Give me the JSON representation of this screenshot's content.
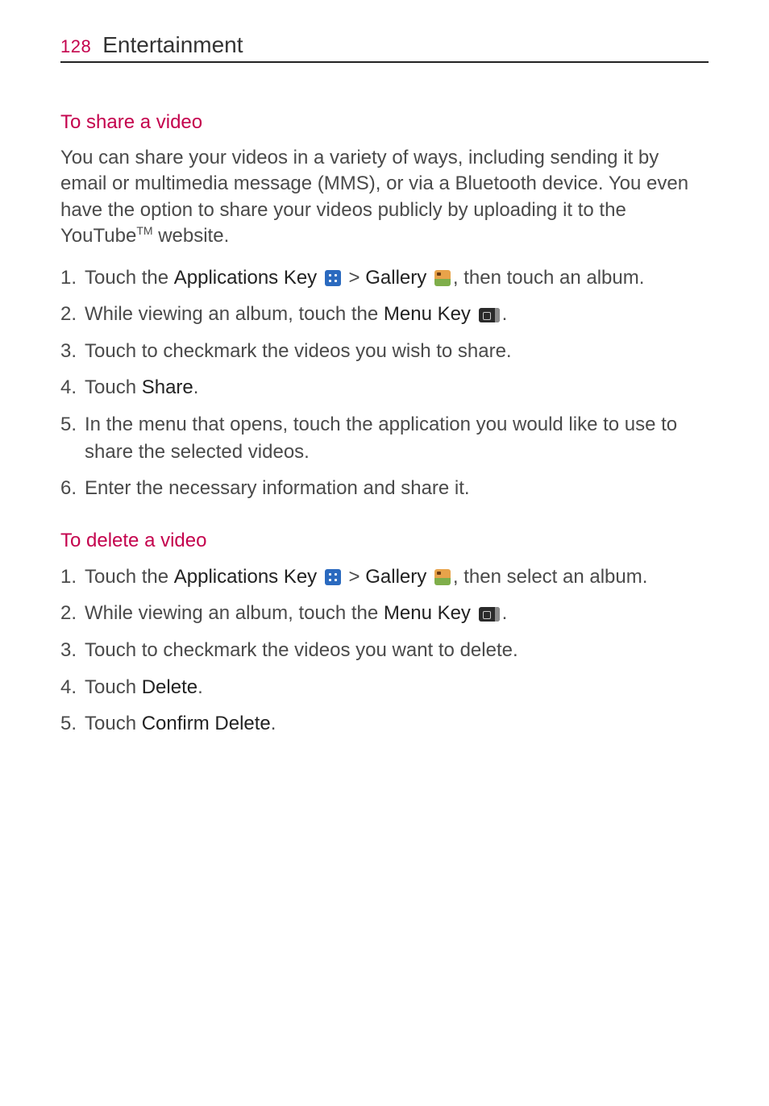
{
  "header": {
    "page_number": "128",
    "chapter_title": "Entertainment"
  },
  "sections": [
    {
      "heading": "To share a video",
      "intro_parts": {
        "pre": "You can share your videos in a variety of ways, including sending it by email or multimedia message (MMS), or via a Bluetooth device. You even have the option to share your videos publicly by uploading it to the YouTube",
        "tm": "TM",
        "post": " website."
      },
      "steps": [
        {
          "segments": [
            {
              "t": "text",
              "v": "Touch the "
            },
            {
              "t": "bold",
              "v": "Applications Key"
            },
            {
              "t": "text",
              "v": " "
            },
            {
              "t": "icon",
              "v": "apps"
            },
            {
              "t": "text",
              "v": " > "
            },
            {
              "t": "bold",
              "v": "Gallery"
            },
            {
              "t": "text",
              "v": " "
            },
            {
              "t": "icon",
              "v": "gallery"
            },
            {
              "t": "text",
              "v": ", then touch an album."
            }
          ]
        },
        {
          "segments": [
            {
              "t": "text",
              "v": "While viewing an album, touch the "
            },
            {
              "t": "bold",
              "v": "Menu Key"
            },
            {
              "t": "text",
              "v": " "
            },
            {
              "t": "icon",
              "v": "menu"
            },
            {
              "t": "text",
              "v": "."
            }
          ]
        },
        {
          "segments": [
            {
              "t": "text",
              "v": "Touch to checkmark the videos you wish to share."
            }
          ]
        },
        {
          "segments": [
            {
              "t": "text",
              "v": "Touch "
            },
            {
              "t": "bold",
              "v": "Share"
            },
            {
              "t": "text",
              "v": "."
            }
          ]
        },
        {
          "segments": [
            {
              "t": "text",
              "v": "In the menu that opens, touch the application you would like to use to share the selected videos."
            }
          ]
        },
        {
          "segments": [
            {
              "t": "text",
              "v": "Enter the necessary information and share it."
            }
          ]
        }
      ]
    },
    {
      "heading": "To delete a video",
      "steps": [
        {
          "segments": [
            {
              "t": "text",
              "v": "Touch the "
            },
            {
              "t": "bold",
              "v": "Applications Key"
            },
            {
              "t": "text",
              "v": " "
            },
            {
              "t": "icon",
              "v": "apps"
            },
            {
              "t": "text",
              "v": " > "
            },
            {
              "t": "bold",
              "v": "Gallery"
            },
            {
              "t": "text",
              "v": " "
            },
            {
              "t": "icon",
              "v": "gallery"
            },
            {
              "t": "text",
              "v": ", then select an album."
            }
          ]
        },
        {
          "segments": [
            {
              "t": "text",
              "v": "While viewing an album, touch the "
            },
            {
              "t": "bold",
              "v": "Menu Key"
            },
            {
              "t": "text",
              "v": " "
            },
            {
              "t": "icon",
              "v": "menu"
            },
            {
              "t": "text",
              "v": "."
            }
          ]
        },
        {
          "segments": [
            {
              "t": "text",
              "v": "Touch to checkmark the videos you want to delete."
            }
          ]
        },
        {
          "segments": [
            {
              "t": "text",
              "v": "Touch "
            },
            {
              "t": "bold",
              "v": "Delete"
            },
            {
              "t": "text",
              "v": "."
            }
          ]
        },
        {
          "segments": [
            {
              "t": "text",
              "v": "Touch "
            },
            {
              "t": "bold",
              "v": "Confirm Delete"
            },
            {
              "t": "text",
              "v": "."
            }
          ]
        }
      ]
    }
  ]
}
